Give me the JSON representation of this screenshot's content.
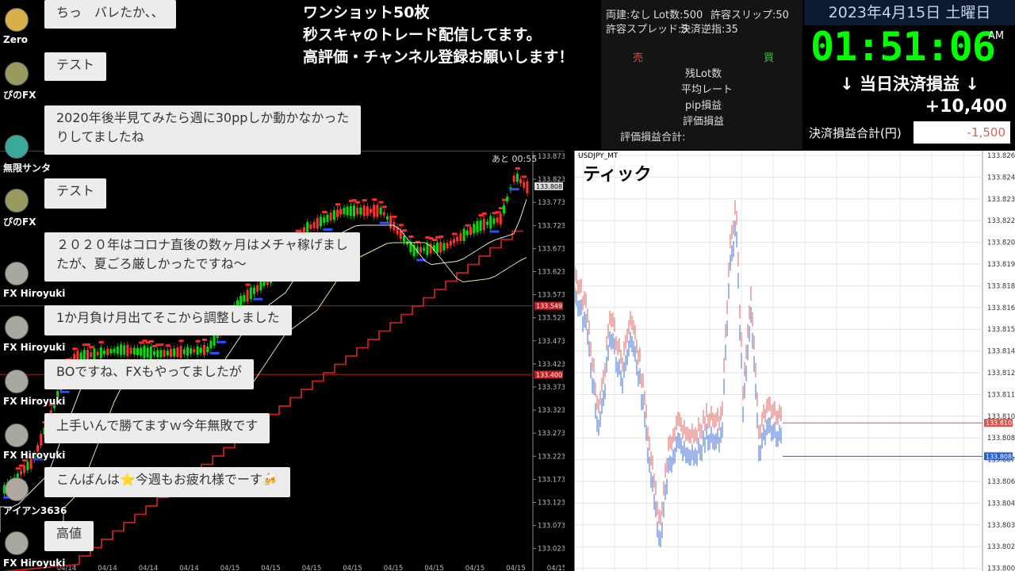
{
  "banner": {
    "line1": "ワンショット50枚",
    "line2": "秒スキャのトレード配信してます。",
    "line3": "高評価・チャンネル登録お願いします！"
  },
  "settings": {
    "hedge": "両建:なし",
    "lots": "Lot数:500",
    "slippage": "許容スリップ:50",
    "spread": "許容スプレッド:5",
    "reverse": "決済逆指:35",
    "sell_label": "売",
    "buy_label": "買",
    "remaining_lots": "残Lot数",
    "avg_rate": "平均レート",
    "pip_pnl": "pip損益",
    "eval_pnl": "評価損益",
    "eval_total": "評価損益合計:"
  },
  "clock": {
    "date": "2023年4月15日 土曜日",
    "time": "01:51:06",
    "ampm": "AM",
    "pnl_header": "↓ 当日決済損益 ↓",
    "pnl_value": "+10,400",
    "total_label": "決済損益合計(円)",
    "total_value": "-1,500"
  },
  "left_chart": {
    "countdown": "あと 00:55",
    "price_ticks": [
      "133.873",
      "133.823",
      "133.773",
      "133.723",
      "133.673",
      "133.623",
      "133.573",
      "133.523",
      "133.473",
      "133.423",
      "133.373",
      "133.323",
      "133.273",
      "133.223",
      "133.173",
      "133.123",
      "133.073",
      "133.023"
    ],
    "current_price": "133.808",
    "marker_red_1": "133.549",
    "marker_red_2": "133.400",
    "date_ticks": [
      "04/14",
      "04/14",
      "04/14",
      "04/14",
      "04/15",
      "04/15",
      "04/15",
      "04/15",
      "04/15",
      "04/15",
      "04/15",
      "04/15",
      "04/15"
    ]
  },
  "right_chart": {
    "symbol": "USDJPY_MT",
    "title": "ティック",
    "price_ticks": [
      "133.826",
      "133.824",
      "133.823",
      "133.822",
      "133.820",
      "133.819",
      "133.818",
      "133.816",
      "133.815",
      "133.814",
      "133.812",
      "133.811",
      "133.810",
      "133.808",
      "133.807",
      "133.806",
      "133.804",
      "133.803",
      "133.802",
      "133.800"
    ],
    "ask_price": "133.810",
    "bid_price": "133.808",
    "ask_color": "#d9534f",
    "bid_color": "#2a5fd0"
  },
  "chat": [
    {
      "user": "Zero",
      "text": "ちっ　バレたか、、"
    },
    {
      "user": "ぴのFX",
      "text": "テスト"
    },
    {
      "user": "無限サンタ",
      "text": "2020年後半見てみたら週に30ppしか動かなかった"
    },
    {
      "user": "",
      "text": "りしてましたね"
    },
    {
      "user": "ぴのFX",
      "text": "テスト"
    },
    {
      "user": "FX Hiroyuki",
      "text": "２０２０年はコロナ直後の数ヶ月はメチャ稼げまし"
    },
    {
      "user": "",
      "text": "たが、夏ごろ厳しかったですね〜"
    },
    {
      "user": "FX Hiroyuki",
      "text": "1か月負け月出てそこから調整しました"
    },
    {
      "user": "FX Hiroyuki",
      "text": "BOですね、FXもやってましたが"
    },
    {
      "user": "FX Hiroyuki",
      "text": "上手いんで勝てますｗ今年無敗です"
    },
    {
      "user": "アイアン3636",
      "text": "こんばんは⭐今週もお疲れ様でーす🍻"
    },
    {
      "user": "FX Hiroyuki",
      "text": "高値"
    },
    {
      "user": "FX Hiroyuki",
      "text": ""
    }
  ],
  "colors": {
    "candle_up": "#00e000",
    "candle_down": "#ff3030",
    "ma_yellow": "#e8e0a0",
    "step_red": "#c81e1e",
    "sell_dot": "#ff2a2a",
    "buy_dot": "#2a50ff"
  }
}
